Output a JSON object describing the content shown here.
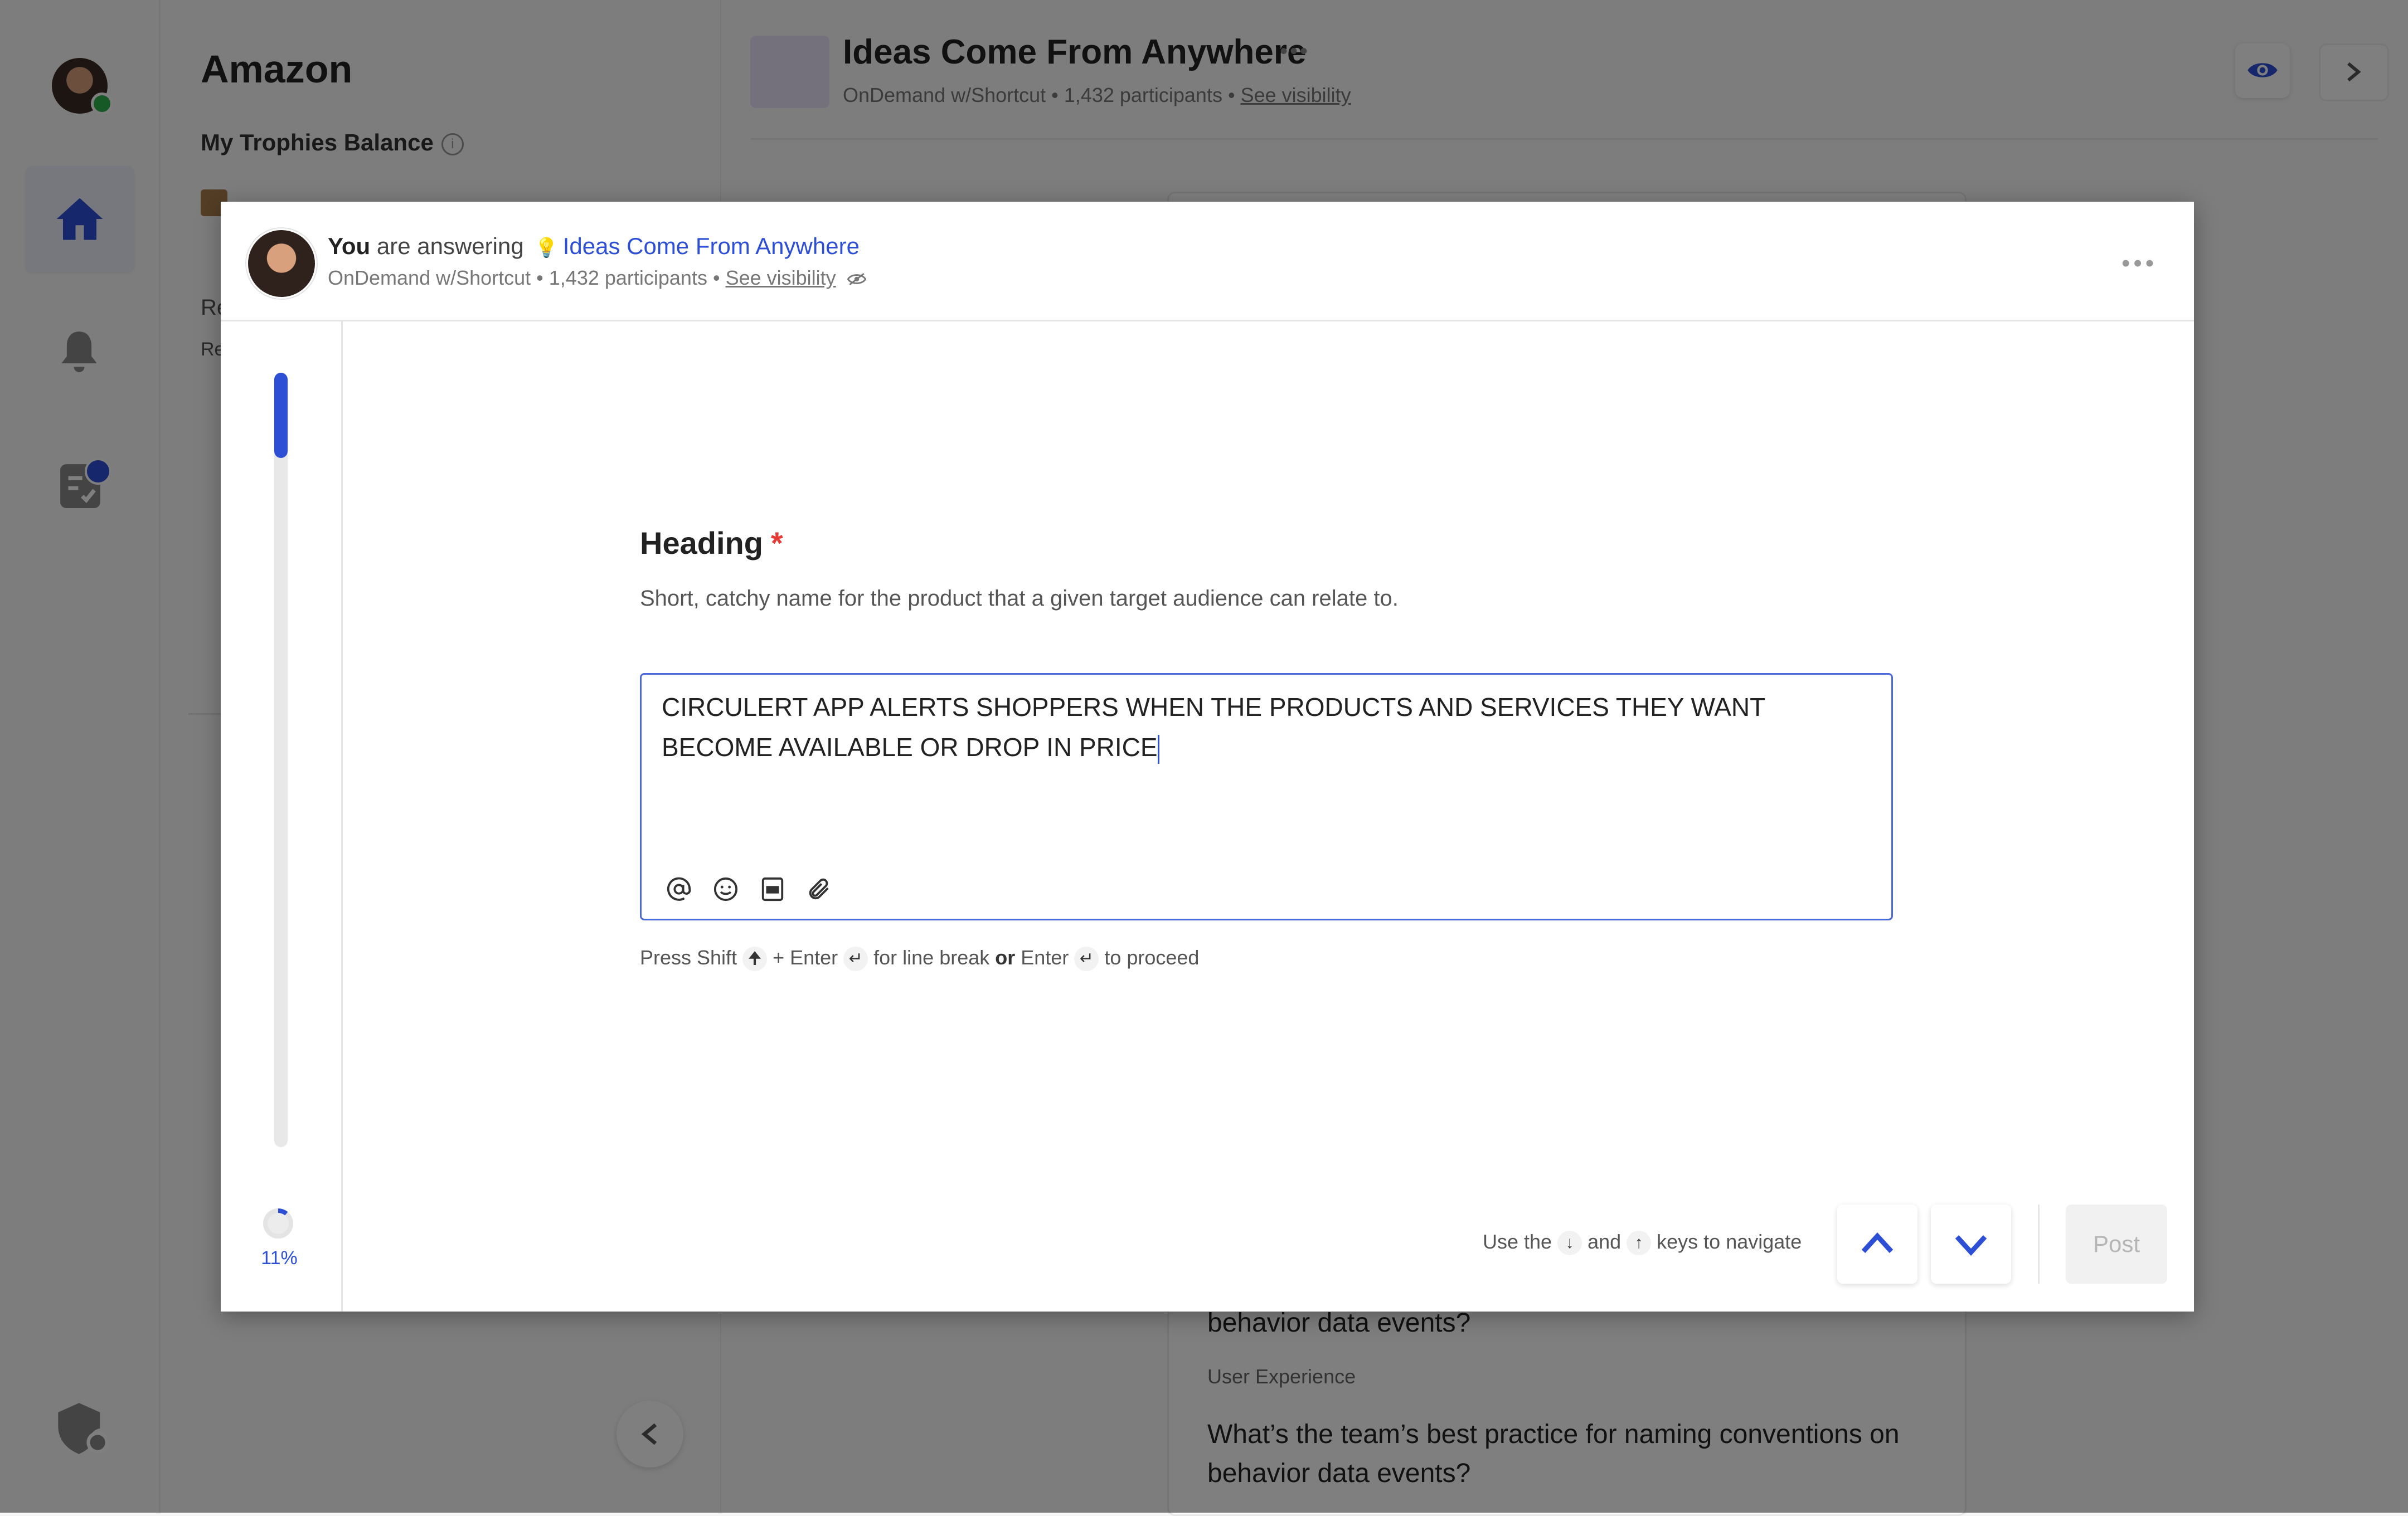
{
  "background": {
    "company": "Amazon",
    "trophies_label": "My Trophies Balance",
    "trophies_value": "",
    "sidebar_fragments": [
      "Re",
      "Re"
    ],
    "challenge_title": "Ideas Come From Anywhere",
    "challenge_meta": "OnDemand w/Shortcut • 1,432 participants • ",
    "see_visibility": "See visibility",
    "feed_q1": "behavior data events?",
    "feed_tag": "User Experience",
    "feed_q2": "What’s the team’s best practice for naming conventions on behavior data events?"
  },
  "modal": {
    "answering_you": "You",
    "answering_text": " are answering ",
    "challenge_link": "Ideas Come From Anywhere",
    "meta": "OnDemand w/Shortcut • 1,432 participants • ",
    "see_visibility": "See visibility",
    "progress_label": "11%",
    "progress_fraction": 0.11
  },
  "question": {
    "heading": "Heading",
    "required_mark": "*",
    "description": "Short, catchy name for the product that a given target audience can relate to.",
    "answer_value": "CIRCULERT APP ALERTS SHOPPERS WHEN THE PRODUCTS AND SERVICES THEY WANT BECOME AVAILABLE OR DROP IN PRICE",
    "toolbar_icons": [
      "mention-icon",
      "emoji-icon",
      "gif-icon",
      "attachment-icon"
    ]
  },
  "hint": {
    "press": "Press Shift",
    "plus_enter": "+ Enter",
    "for_line_break": "for line break",
    "or": "or",
    "enter": "Enter",
    "to_proceed": "to proceed"
  },
  "navigation": {
    "use_the": "Use the",
    "and": "and",
    "keys_to_navigate": "keys to navigate",
    "post_label": "Post"
  },
  "colors": {
    "accent": "#2d4fd6",
    "required": "#e53935",
    "online": "#2fb24c"
  }
}
